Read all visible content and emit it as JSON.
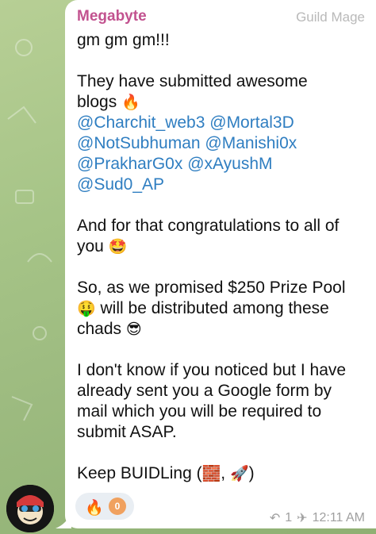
{
  "message": {
    "sender": "Megabyte",
    "role": "Guild Mage",
    "lines": {
      "l1": "gm gm gm!!!",
      "l2": "They have submitted awesome",
      "l3a": "blogs",
      "m1": "@Charchit_web3",
      "m2": "@Mortal3D",
      "m3": "@NotSubhuman",
      "m4": "@Manishi0x",
      "m5": "@PrakharG0x",
      "m6": "@xAyushM",
      "m7": "@Sud0_AP",
      "l4": "And for that congratulations to all of",
      "l5": "you",
      "l6": "So, as we promised $250 Prize Pool",
      "l7": "will be distributed among these",
      "l8": "chads",
      "l9": "I don't know if you noticed but I have",
      "l10": "already sent you a Google form by",
      "l11": "mail which you will be required to",
      "l12": "submit ASAP.",
      "l13a": "Keep BUIDLing (",
      "l13b": ",",
      "l13c": ")"
    },
    "emojis": {
      "fire": "🔥",
      "starstruck": "🤩",
      "money_mouth": "🤑",
      "sunglasses": "😎",
      "bricks": "🧱",
      "rocket": "🚀"
    },
    "reaction": {
      "emoji": "🔥",
      "count": "0"
    },
    "meta": {
      "replies": "1",
      "time": "12:11 AM",
      "reply_icon": "reply-icon",
      "pin_icon": "pin-icon"
    }
  },
  "colors": {
    "sender": "#c2528f",
    "mention": "#2f7ec1",
    "reaction_badge": "#f0a15f"
  }
}
